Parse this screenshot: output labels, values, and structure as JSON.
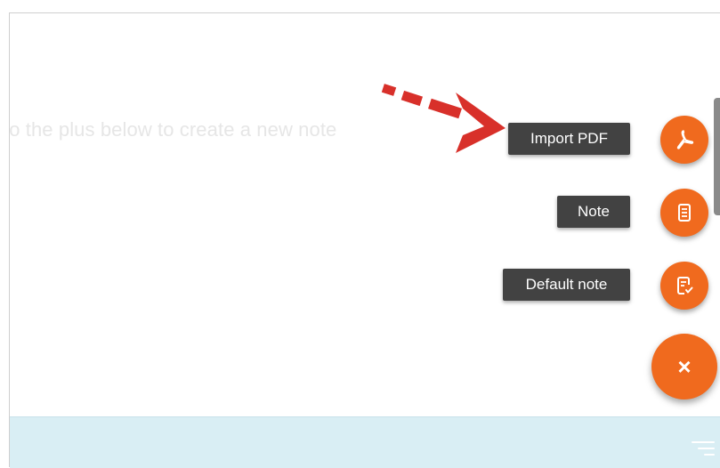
{
  "empty_state": {
    "hint": "to the plus below to create a new note"
  },
  "speed_dial": {
    "actions": [
      {
        "label": "Import PDF",
        "icon": "pdf-icon"
      },
      {
        "label": "Note",
        "icon": "note-document-icon"
      },
      {
        "label": "Default note",
        "icon": "default-note-check-icon"
      }
    ],
    "close_label": "×"
  },
  "colors": {
    "accent": "#f06a1e",
    "chip_background": "#424242",
    "bottom_bar": "#d9eef4",
    "annotation_arrow": "#d8302a"
  },
  "bottom_bar": {
    "icon": "sort-icon"
  }
}
